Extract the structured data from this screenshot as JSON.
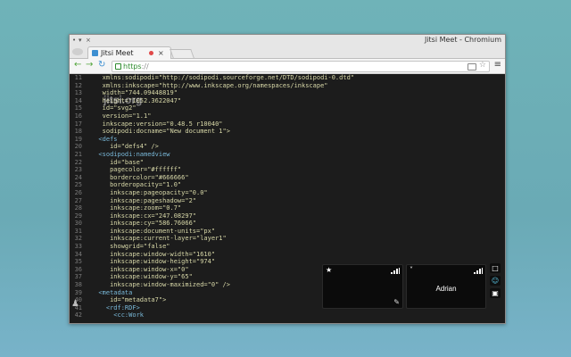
{
  "window": {
    "title": "Jitsi Meet - Chromium",
    "controls": [
      "•",
      "▾",
      "×"
    ]
  },
  "tab": {
    "label": "Jitsi Meet",
    "close": "×"
  },
  "toolbar": {
    "back": "←",
    "forward": "→",
    "reload": "↻",
    "url_prefix": "https",
    "url_rest": "://",
    "menu": "≡",
    "star": "☆"
  },
  "editor": {
    "lines": [
      {
        "n": "11",
        "text": "   xmlns:sodipodi=\"http://sodipodi.sourceforge.net/DTD/sodipodi-0.dtd\""
      },
      {
        "n": "12",
        "text": "   xmlns:inkscape=\"http://www.inkscape.org/namespaces/inkscape\""
      },
      {
        "n": "13",
        "text": "   width=\"744.09448819\""
      },
      {
        "n": "14",
        "text": "   height=\"1052.3622047\""
      },
      {
        "n": "15",
        "text": "   id=\"svg2\""
      },
      {
        "n": "16",
        "text": "   version=\"1.1\""
      },
      {
        "n": "17",
        "text": "   inkscape:version=\"0.48.5 r10040\""
      },
      {
        "n": "18",
        "text": "   sodipodi:docname=\"New document 1\">"
      },
      {
        "n": "19",
        "text": "  <defs"
      },
      {
        "n": "20",
        "text": "     id=\"defs4\" />"
      },
      {
        "n": "21",
        "text": "  <sodipodi:namedview"
      },
      {
        "n": "22",
        "text": "     id=\"base\""
      },
      {
        "n": "23",
        "text": "     pagecolor=\"#ffffff\""
      },
      {
        "n": "24",
        "text": "     bordercolor=\"#666666\""
      },
      {
        "n": "25",
        "text": "     borderopacity=\"1.0\""
      },
      {
        "n": "26",
        "text": "     inkscape:pageopacity=\"0.0\""
      },
      {
        "n": "27",
        "text": "     inkscape:pageshadow=\"2\""
      },
      {
        "n": "28",
        "text": "     inkscape:zoom=\"0.7\""
      },
      {
        "n": "29",
        "text": "     inkscape:cx=\"247.08297\""
      },
      {
        "n": "30",
        "text": "     inkscape:cy=\"586.76066\""
      },
      {
        "n": "31",
        "text": "     inkscape:document-units=\"px\""
      },
      {
        "n": "32",
        "text": "     inkscape:current-layer=\"layer1\""
      },
      {
        "n": "33",
        "text": "     showgrid=\"false\""
      },
      {
        "n": "34",
        "text": "     inkscape:window-width=\"1610\""
      },
      {
        "n": "35",
        "text": "     inkscape:window-height=\"974\""
      },
      {
        "n": "36",
        "text": "     inkscape:window-x=\"0\""
      },
      {
        "n": "37",
        "text": "     inkscape:window-y=\"65\""
      },
      {
        "n": "38",
        "text": "     inkscape:window-maximized=\"0\" />"
      },
      {
        "n": "39",
        "text": "  <metadata"
      },
      {
        "n": "40",
        "text": "     id=\"metadata7\">"
      },
      {
        "n": "41",
        "text": "    <rdf:RDF>"
      },
      {
        "n": "42",
        "text": "      <cc:Work"
      }
    ]
  },
  "watermark": "jitsi.org",
  "video": {
    "local": {
      "top_icon": "★",
      "pencil": "✎"
    },
    "remote": {
      "top_icon": "˅",
      "name": "Adrian"
    }
  },
  "sidebar": {
    "chat_icon": "□",
    "contacts_icon": "☺",
    "settings_icon": "▣"
  }
}
